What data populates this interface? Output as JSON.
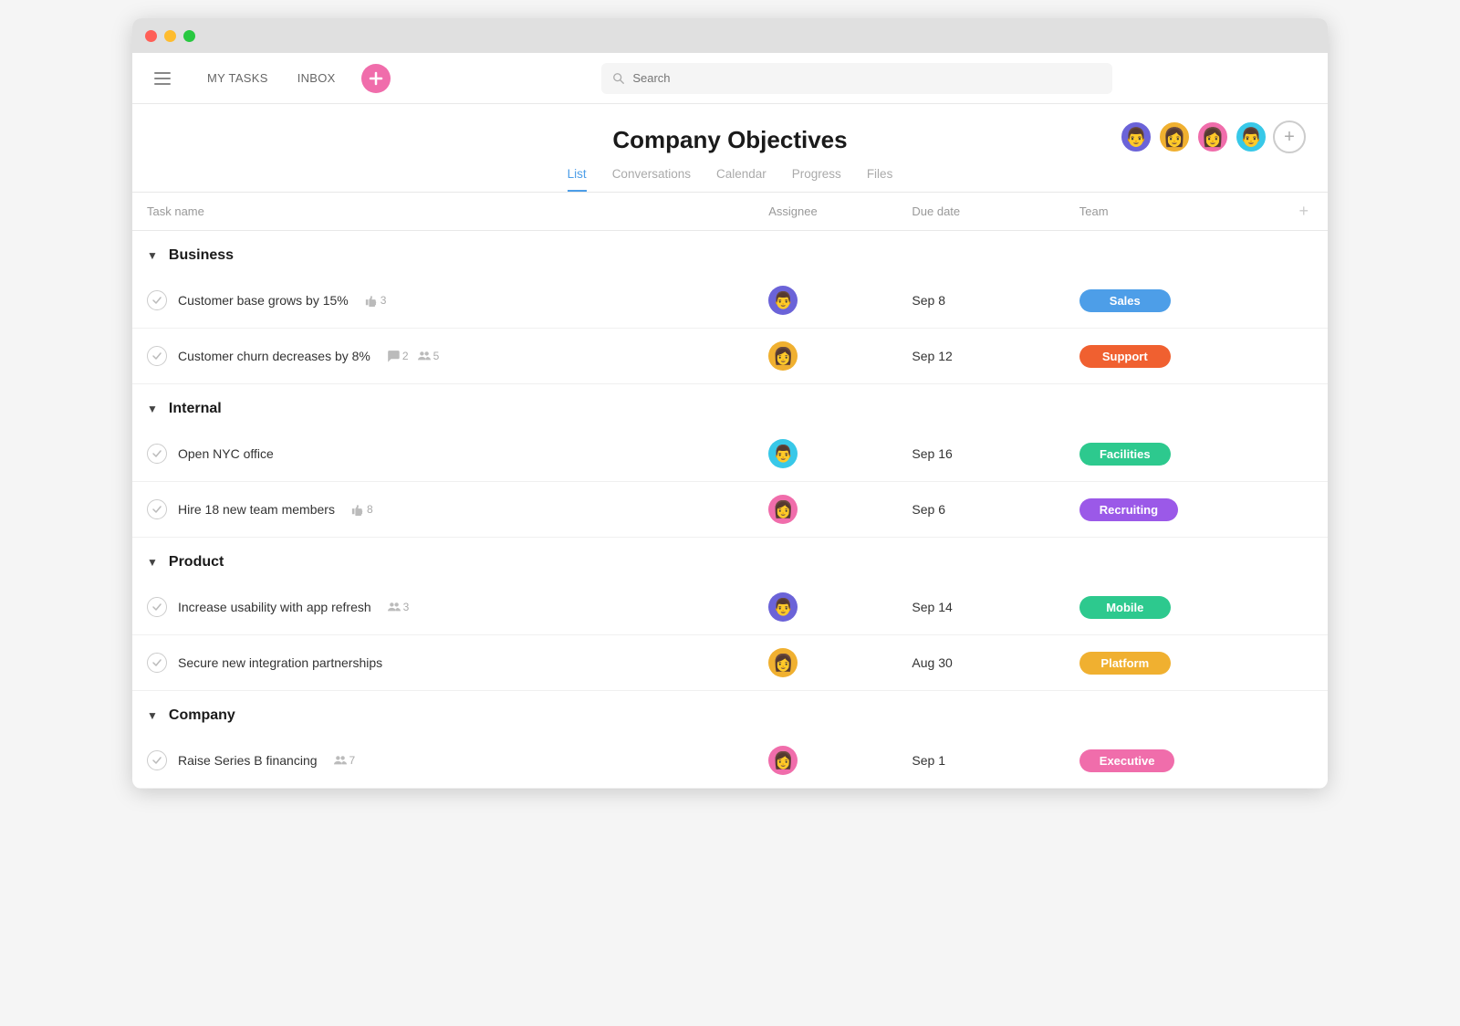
{
  "window": {
    "dots": [
      "red",
      "yellow",
      "green"
    ]
  },
  "topnav": {
    "my_tasks": "MY TASKS",
    "inbox": "INBOX",
    "search_placeholder": "Search"
  },
  "header": {
    "title": "Company Objectives",
    "tabs": [
      "List",
      "Conversations",
      "Calendar",
      "Progress",
      "Files"
    ],
    "active_tab": "List"
  },
  "table": {
    "columns": [
      "Task name",
      "Assignee",
      "Due date",
      "Team"
    ],
    "sections": [
      {
        "name": "Business",
        "tasks": [
          {
            "name": "Customer base grows by 15%",
            "meta": [
              {
                "type": "like",
                "count": "3"
              }
            ],
            "assignee": "av1",
            "due": "Sep 8",
            "team": "Sales",
            "team_class": "badge-sales"
          },
          {
            "name": "Customer churn decreases by 8%",
            "meta": [
              {
                "type": "comment",
                "count": "2"
              },
              {
                "type": "collab",
                "count": "5"
              }
            ],
            "assignee": "av2",
            "due": "Sep 12",
            "team": "Support",
            "team_class": "badge-support"
          }
        ]
      },
      {
        "name": "Internal",
        "tasks": [
          {
            "name": "Open NYC office",
            "meta": [],
            "assignee": "av3",
            "due": "Sep 16",
            "team": "Facilities",
            "team_class": "badge-facilities"
          },
          {
            "name": "Hire 18 new team members",
            "meta": [
              {
                "type": "like",
                "count": "8"
              }
            ],
            "assignee": "av4",
            "due": "Sep 6",
            "team": "Recruiting",
            "team_class": "badge-recruiting"
          }
        ]
      },
      {
        "name": "Product",
        "tasks": [
          {
            "name": "Increase usability with app refresh",
            "meta": [
              {
                "type": "collab",
                "count": "3"
              }
            ],
            "assignee": "av5",
            "due": "Sep 14",
            "team": "Mobile",
            "team_class": "badge-mobile"
          },
          {
            "name": "Secure new integration partnerships",
            "meta": [],
            "assignee": "av6",
            "due": "Aug 30",
            "team": "Platform",
            "team_class": "badge-platform"
          }
        ]
      },
      {
        "name": "Company",
        "tasks": [
          {
            "name": "Raise Series B financing",
            "meta": [
              {
                "type": "collab",
                "count": "7"
              }
            ],
            "assignee": "av7",
            "due": "Sep 1",
            "team": "Executive",
            "team_class": "badge-executive"
          }
        ]
      }
    ]
  },
  "avatars": {
    "av1": {
      "color": "#6b63d8",
      "emoji": "👨"
    },
    "av2": {
      "color": "#f0b030",
      "emoji": "👩"
    },
    "av3": {
      "color": "#38c8e8",
      "emoji": "👨"
    },
    "av4": {
      "color": "#f06dab",
      "emoji": "👩"
    },
    "av5": {
      "color": "#6b63d8",
      "emoji": "👨"
    },
    "av6": {
      "color": "#f0b030",
      "emoji": "👩"
    },
    "av7": {
      "color": "#f06dab",
      "emoji": "👩"
    }
  },
  "header_avatars": [
    {
      "color": "#6b63d8",
      "emoji": "👨"
    },
    {
      "color": "#f0b030",
      "emoji": "👩"
    },
    {
      "color": "#f06dab",
      "emoji": "👩"
    },
    {
      "color": "#38c8e8",
      "emoji": "👨"
    }
  ]
}
